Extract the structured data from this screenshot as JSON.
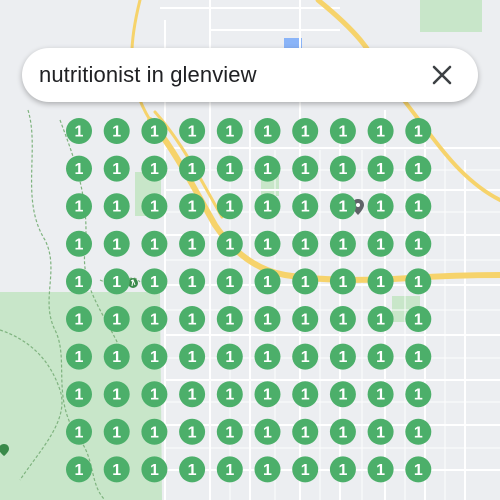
{
  "search": {
    "query": "nutritionist in glenview",
    "clear_icon": "close-icon"
  },
  "map": {
    "type": "map",
    "colors": {
      "land": "#eceef1",
      "park": "#c8e6c9",
      "road": "#ffffff",
      "highway": "#f6d36b",
      "trail": "#7fb37f",
      "water": "#8ab4f8",
      "marker": "#4caf6a",
      "marker_text": "#ffffff"
    },
    "grid": {
      "rows": 10,
      "cols": 10,
      "values": [
        [
          1,
          1,
          1,
          1,
          1,
          1,
          1,
          1,
          1,
          1
        ],
        [
          1,
          1,
          1,
          1,
          1,
          1,
          1,
          1,
          1,
          1
        ],
        [
          1,
          1,
          1,
          1,
          1,
          1,
          1,
          1,
          1,
          1
        ],
        [
          1,
          1,
          1,
          1,
          1,
          1,
          1,
          1,
          1,
          1
        ],
        [
          1,
          1,
          1,
          1,
          1,
          1,
          1,
          1,
          1,
          1
        ],
        [
          1,
          1,
          1,
          1,
          1,
          1,
          1,
          1,
          1,
          1
        ],
        [
          1,
          1,
          1,
          1,
          1,
          1,
          1,
          1,
          1,
          1
        ],
        [
          1,
          1,
          1,
          1,
          1,
          1,
          1,
          1,
          1,
          1
        ],
        [
          1,
          1,
          1,
          1,
          1,
          1,
          1,
          1,
          1,
          1
        ],
        [
          1,
          1,
          1,
          1,
          1,
          1,
          1,
          1,
          1,
          1
        ]
      ]
    },
    "poi_icons": [
      "pin-icon",
      "trailhead-icon",
      "pin-icon"
    ]
  }
}
